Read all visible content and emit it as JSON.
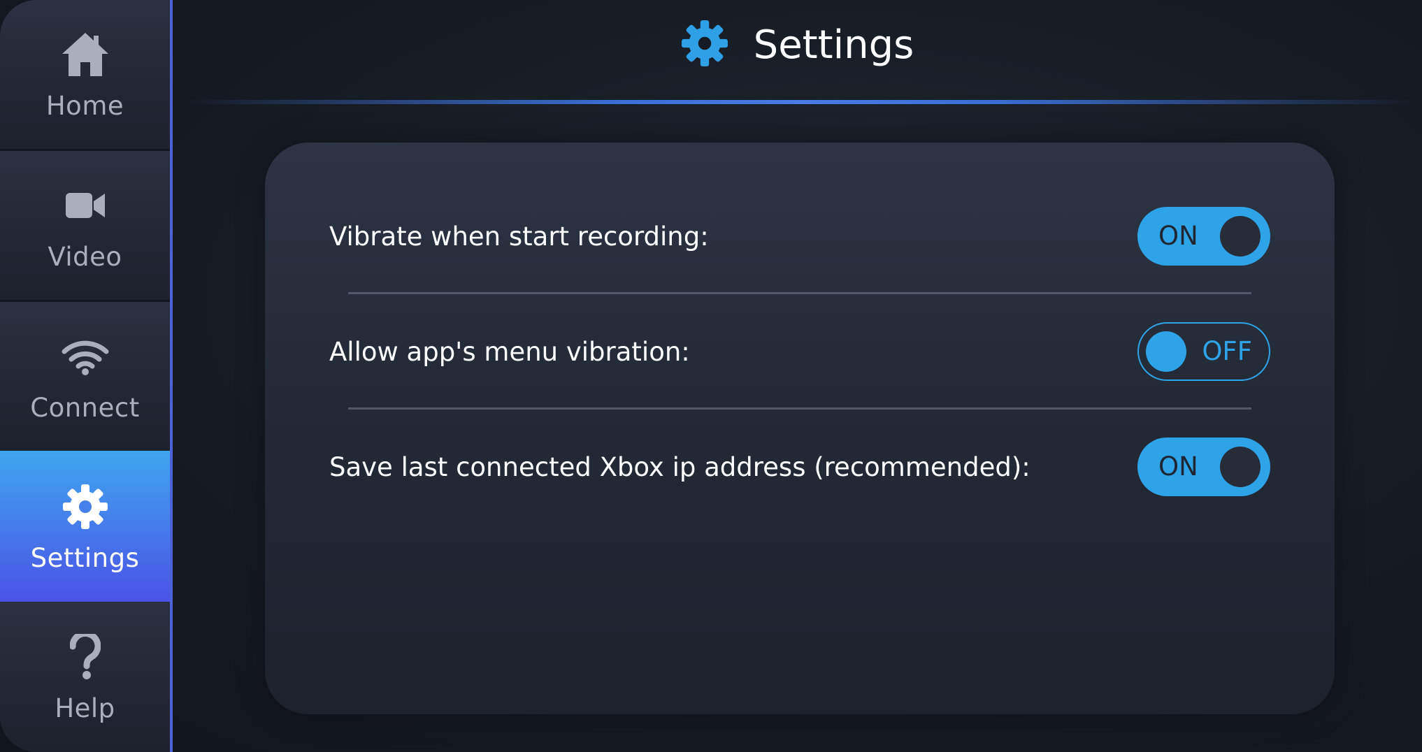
{
  "sidebar": {
    "items": [
      {
        "label": "Home",
        "icon": "home-icon",
        "active": false
      },
      {
        "label": "Video",
        "icon": "video-camera-icon",
        "active": false
      },
      {
        "label": "Connect",
        "icon": "wifi-icon",
        "active": false
      },
      {
        "label": "Settings",
        "icon": "gear-icon",
        "active": true
      },
      {
        "label": "Help",
        "icon": "question-mark-icon",
        "active": false
      }
    ]
  },
  "header": {
    "title": "Settings",
    "icon": "gear-icon"
  },
  "settings": [
    {
      "label": "Vibrate when start recording:",
      "state": "ON"
    },
    {
      "label": "Allow app's menu vibration:",
      "state": "OFF"
    },
    {
      "label": "Save last connected Xbox ip address (recommended):",
      "state": "ON"
    }
  ],
  "colors": {
    "accent": "#2fa3e8",
    "active_nav_top": "#3fa6ef",
    "active_nav_bottom": "#4b52e6",
    "sidebar_border": "#4b62d8"
  }
}
